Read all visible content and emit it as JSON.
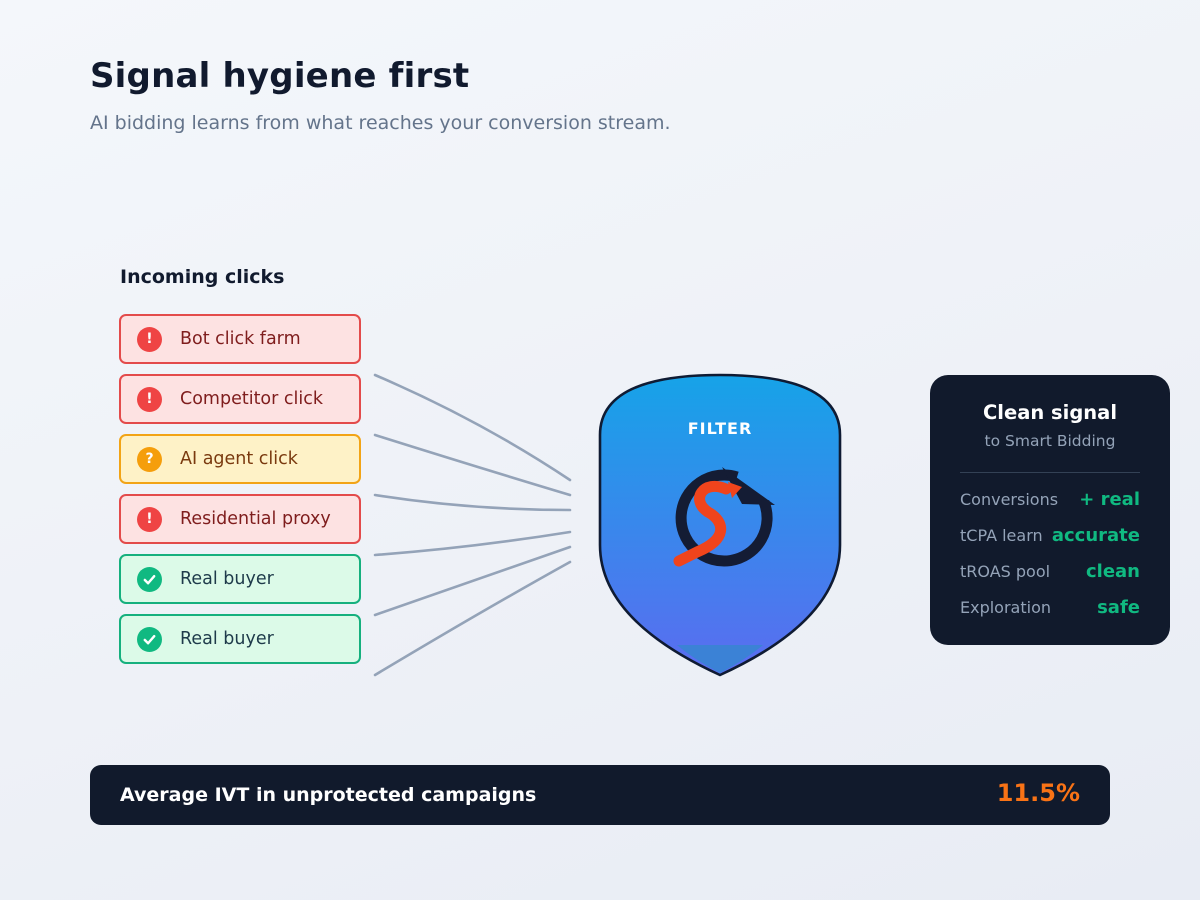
{
  "header": {
    "title": "Signal hygiene first",
    "subtitle": "AI bidding learns from what reaches your conversion stream."
  },
  "incoming": {
    "label": "Incoming clicks",
    "items": [
      {
        "label": "Bot click farm",
        "status": "danger",
        "badge_glyph": "!"
      },
      {
        "label": "Competitor click",
        "status": "danger",
        "badge_glyph": "!"
      },
      {
        "label": "AI agent click",
        "status": "warning",
        "badge_glyph": "?"
      },
      {
        "label": "Residential proxy",
        "status": "danger",
        "badge_glyph": "!"
      },
      {
        "label": "Real buyer",
        "status": "success",
        "badge_glyph": "check-icon"
      },
      {
        "label": "Real buyer",
        "status": "success",
        "badge_glyph": "check-icon"
      }
    ]
  },
  "filter": {
    "label": "FILTER",
    "logo": "brand-logo-icon",
    "colors": {
      "top": "#16a3e8",
      "bottom": "#5b6cf0",
      "outline": "#0f1b33"
    }
  },
  "clean_panel": {
    "title": "Clean signal",
    "subtitle": "to Smart Bidding",
    "metrics": [
      {
        "label": "Conversions",
        "value": "+ real"
      },
      {
        "label": "tCPA learn",
        "value": "accurate"
      },
      {
        "label": "tROAS pool",
        "value": "clean"
      },
      {
        "label": "Exploration",
        "value": "safe"
      }
    ]
  },
  "footer": {
    "label": "Average IVT in unprotected campaigns",
    "value": "11.5%"
  },
  "colors": {
    "danger": "#ef4444",
    "warning": "#f59e0b",
    "success": "#10b981",
    "dark_panel": "#111a2c",
    "highlight_orange": "#f97316"
  }
}
